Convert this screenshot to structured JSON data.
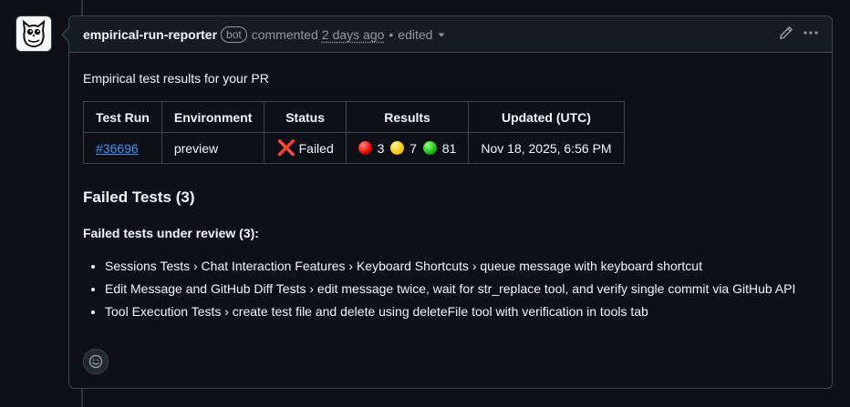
{
  "header": {
    "author": "empirical-run-reporter",
    "badge": "bot",
    "action": "commented",
    "time": "2 days ago",
    "separator": "•",
    "edited": "edited"
  },
  "body": {
    "intro": "Empirical test results for your PR",
    "table": {
      "headers": [
        "Test Run",
        "Environment",
        "Status",
        "Results",
        "Updated (UTC)"
      ],
      "row": {
        "test_run": "#36696",
        "environment": "preview",
        "status_icon": "❌",
        "status": "Failed",
        "results": {
          "failed": "3",
          "flaky": "7",
          "passed": "81"
        },
        "updated": "Nov 18, 2025, 6:56 PM"
      }
    },
    "failed_heading": "Failed Tests (3)",
    "review_heading": "Failed tests under review (3):",
    "failed_tests": [
      "Sessions Tests › Chat Interaction Features › Keyboard Shortcuts › queue message with keyboard shortcut",
      "Edit Message and GitHub Diff Tests › edit message twice, wait for str_replace tool, and verify single commit via GitHub API",
      "Tool Execution Tests › create test file and delete using deleteFile tool with verification in tools tab"
    ]
  },
  "colors": {
    "background": "#0d1117",
    "header_bg": "#151b23",
    "border": "#3d444d",
    "link": "#4493f8",
    "muted": "#9198a1",
    "text": "#f0f6fc"
  },
  "icons": {
    "avatar": "owl-avatar-icon",
    "edit": "pencil-icon",
    "more": "kebab-horizontal-icon",
    "dropdown": "triangle-down-icon",
    "reaction": "smiley-icon"
  }
}
